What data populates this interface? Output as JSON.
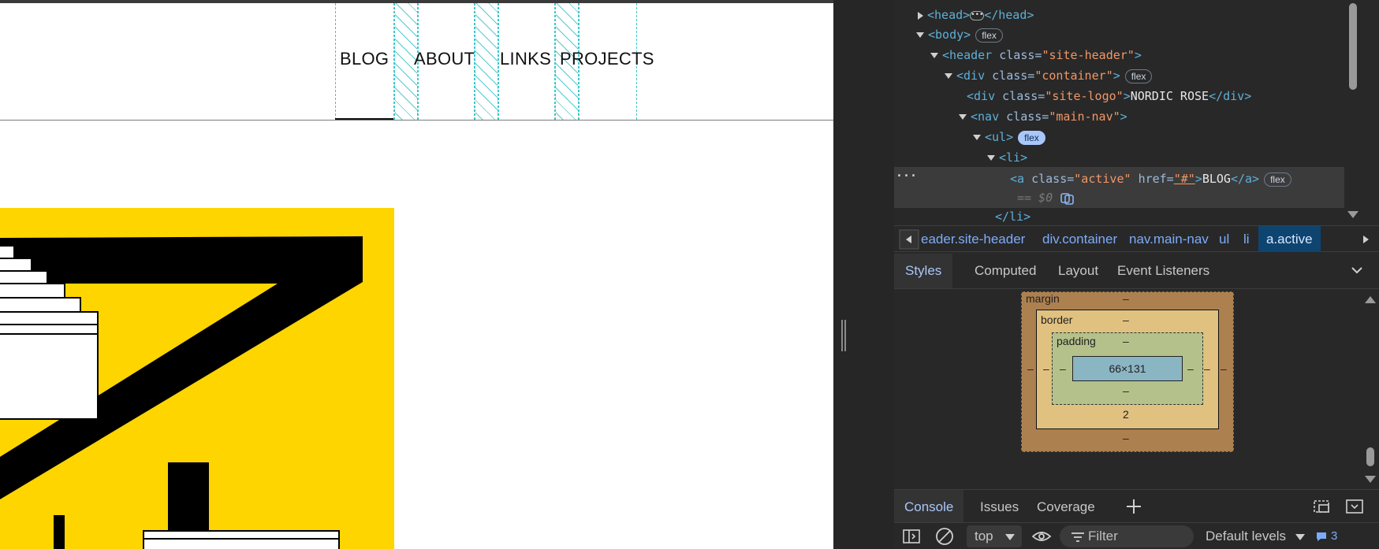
{
  "page": {
    "nav": {
      "items": [
        "BLOG",
        "ABOUT",
        "LINKS",
        "PROJECTS"
      ],
      "active": "BLOG"
    }
  },
  "devtools": {
    "dom": {
      "head_open": "<head>",
      "head_close": "</head>",
      "body_open": "<body>",
      "header_tag": "<header",
      "header_attr": "class=",
      "header_val": "\"site-header\"",
      "div_tag": "<div",
      "div_attr": "class=",
      "div_val": "\"container\"",
      "logo_tag": "<div",
      "logo_attr": "class=",
      "logo_val": "\"site-logo\"",
      "logo_text": "NORDIC ROSE",
      "logo_close": "</div>",
      "nav_tag": "<nav",
      "nav_attr": "class=",
      "nav_val": "\"main-nav\"",
      "ul_tag": "<ul>",
      "li_tag": "<li>",
      "a_tag": "<a",
      "a_class_attr": "class=",
      "a_class_val": "\"active\"",
      "a_href_attr": "href=",
      "a_href_val": "\"#\"",
      "a_text": "BLOG",
      "a_close": "</a>",
      "eq0": "== $0",
      "li_close": "</li>",
      "badge_flex": "flex"
    },
    "breadcrumbs": [
      "eader.site-header",
      "div.container",
      "nav.main-nav",
      "ul",
      "li",
      "a.active"
    ],
    "panel_tabs": [
      "Styles",
      "Computed",
      "Layout",
      "Event Listeners"
    ],
    "active_panel_tab": "Styles",
    "box_model": {
      "margin_label": "margin",
      "border_label": "border",
      "padding_label": "padding",
      "content_size": "66×131",
      "dash": "–",
      "border_bottom": "2"
    },
    "drawer_tabs": [
      "Console",
      "Issues",
      "Coverage"
    ],
    "active_drawer_tab": "Console",
    "console": {
      "context": "top",
      "filter_placeholder": "Filter",
      "levels": "Default levels",
      "message_count": "3"
    }
  },
  "colors": {
    "hero_yellow": "#ffd500",
    "flex_overlay": "#3fc7c9",
    "devtools_bg": "#282828",
    "selection": "#0e4470"
  }
}
